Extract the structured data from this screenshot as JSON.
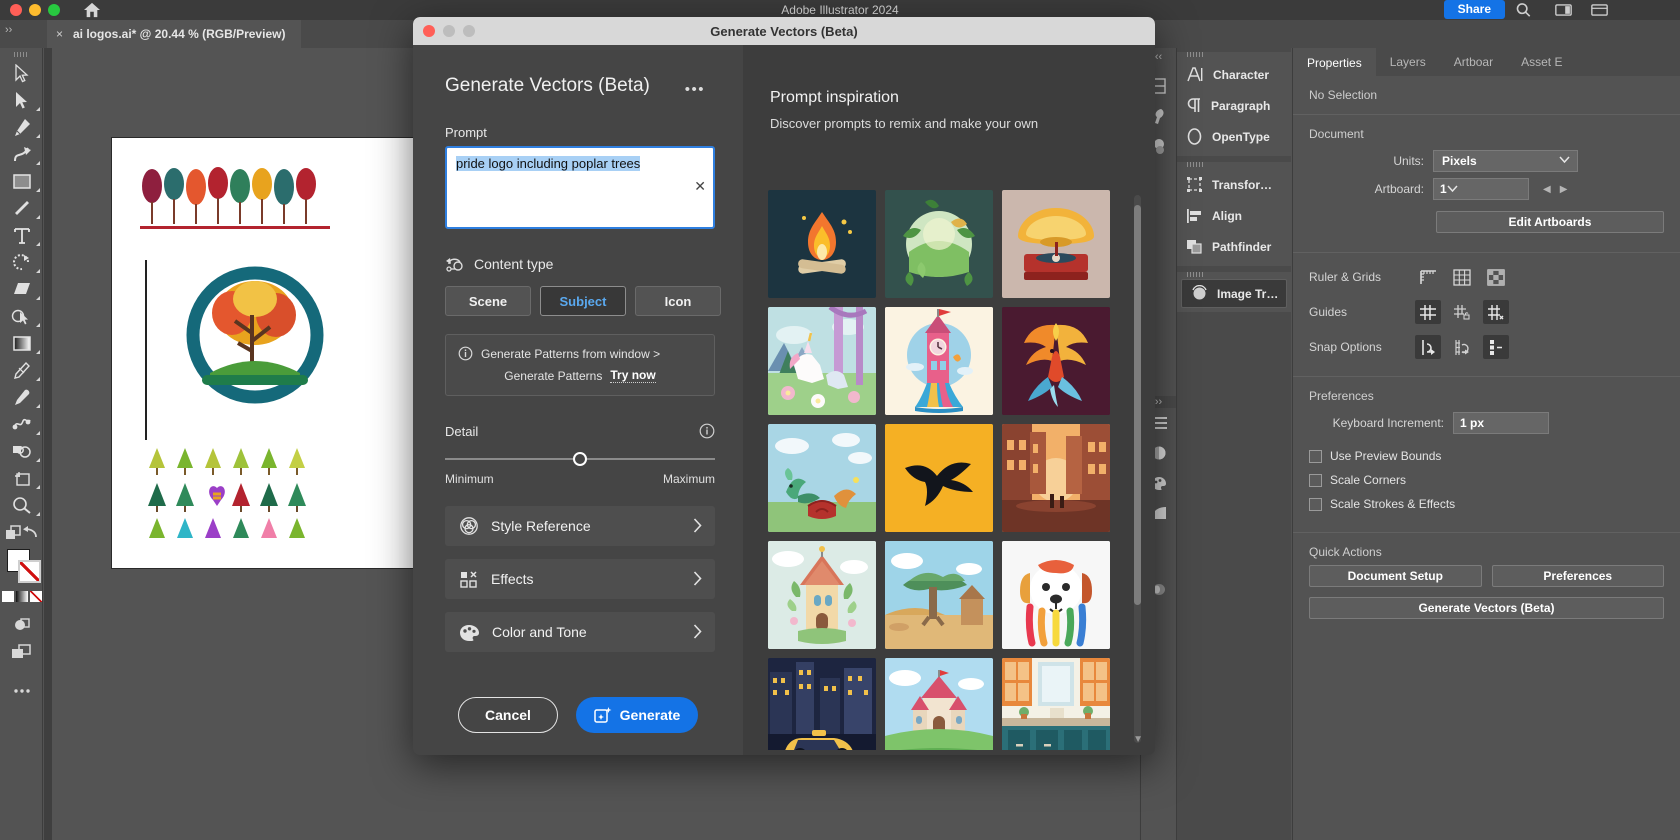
{
  "window": {
    "app_title": "Adobe Illustrator 2024",
    "share_label": "Share",
    "document_tab": "ai logos.ai* @ 20.44 % (RGB/Preview)",
    "tab_close": "×",
    "chevrons_left": "‹‹",
    "chevrons_right": "››"
  },
  "modal": {
    "titlebar": "Generate Vectors (Beta)",
    "heading": "Generate Vectors (Beta)",
    "overflow_menu": "•••",
    "prompt_label": "Prompt",
    "prompt_value": "pride logo including poplar trees",
    "prompt_clear": "✕",
    "content_type_label": "Content type",
    "content_types": [
      {
        "label": "Scene",
        "selected": false
      },
      {
        "label": "Subject",
        "selected": true
      },
      {
        "label": "Icon",
        "selected": false
      }
    ],
    "info_line1": "Generate Patterns from window >",
    "info_line2": "Generate Patterns",
    "info_link": "Try now",
    "detail_label": "Detail",
    "detail_min": "Minimum",
    "detail_max": "Maximum",
    "detail_value": 50,
    "accordions": [
      {
        "label": "Style Reference",
        "icon": "venn-circles-icon"
      },
      {
        "label": "Effects",
        "icon": "effects-grid-icon"
      },
      {
        "label": "Color and Tone",
        "icon": "palette-icon"
      }
    ],
    "cancel_label": "Cancel",
    "generate_label": "Generate",
    "inspiration_title": "Prompt inspiration",
    "inspiration_subtitle": "Discover prompts to remix and make your own",
    "accent_blue": "#1473e6",
    "selection_blue": "#a8d0f5",
    "gallery": [
      {
        "name": "campfire",
        "bg": "#1c3440"
      },
      {
        "name": "leafy-globe",
        "bg": "#33514d"
      },
      {
        "name": "gramophone",
        "bg": "#cbb7ad"
      },
      {
        "name": "unicorn-forest",
        "bg": "#8fc1c4"
      },
      {
        "name": "rainbow-clock-tower",
        "bg": "#fbf3e2"
      },
      {
        "name": "phoenix",
        "bg": "#4a1a30"
      },
      {
        "name": "dragon-sky",
        "bg": "#8fc4d6"
      },
      {
        "name": "bird-silhouette",
        "bg": "#f5b024"
      },
      {
        "name": "desert-street",
        "bg": "#7c4535"
      },
      {
        "name": "fairy-tower",
        "bg": "#cfe5e0"
      },
      {
        "name": "savannah-tree",
        "bg": "#8fc7dd"
      },
      {
        "name": "rainbow-dog",
        "bg": "#f2f2f2"
      },
      {
        "name": "night-city-taxi",
        "bg": "#1d2540"
      },
      {
        "name": "castle-hill",
        "bg": "#a8d8ee"
      },
      {
        "name": "kitchen-interior",
        "bg": "#f0efe7"
      }
    ]
  },
  "properties": {
    "tabs": [
      {
        "label": "Properties",
        "active": true
      },
      {
        "label": "Layers",
        "active": false
      },
      {
        "label": "Artboar",
        "active": false
      },
      {
        "label": "Asset E",
        "active": false
      }
    ],
    "selection_status": "No Selection",
    "document_section": "Document",
    "units_label": "Units:",
    "units_value": "Pixels",
    "artboard_label": "Artboard:",
    "artboard_value": "1",
    "edit_artboards": "Edit Artboards",
    "ruler_grids_label": "Ruler & Grids",
    "guides_label": "Guides",
    "snap_options_label": "Snap Options",
    "preferences_section": "Preferences",
    "keyboard_increment_label": "Keyboard Increment:",
    "keyboard_increment_value": "1 px",
    "checkboxes": [
      {
        "label": "Use Preview Bounds",
        "checked": false
      },
      {
        "label": "Scale Corners",
        "checked": false
      },
      {
        "label": "Scale Strokes & Effects",
        "checked": false
      }
    ],
    "quick_actions_section": "Quick Actions",
    "quick_actions": [
      "Document Setup",
      "Preferences",
      "Generate Vectors (Beta)"
    ]
  },
  "panel_rail": {
    "group1": [
      {
        "label": "Character",
        "icon": "character-icon",
        "selected": false
      },
      {
        "label": "Paragraph",
        "icon": "paragraph-icon",
        "selected": false
      },
      {
        "label": "OpenType",
        "icon": "opentype-icon",
        "selected": false
      }
    ],
    "group2": [
      {
        "label": "Transfor…",
        "icon": "transform-icon",
        "selected": false
      },
      {
        "label": "Align",
        "icon": "align-icon",
        "selected": false
      },
      {
        "label": "Pathfinder",
        "icon": "pathfinder-icon",
        "selected": false
      }
    ],
    "group3": [
      {
        "label": "Image Tr…",
        "icon": "image-trace-icon",
        "selected": true
      }
    ]
  },
  "toolbar": {
    "tools": [
      "selection-tool",
      "direct-selection-tool",
      "pen-tool",
      "curvature-tool",
      "rectangle-tool",
      "paintbrush-tool",
      "type-tool",
      "rotate-tool",
      "eraser-tool",
      "shaper-tool",
      "gradient-tool",
      "width-tool",
      "eyedropper-tool",
      "blend-tool",
      "shape-builder-tool",
      "artboard-tool",
      "zoom-tool",
      "arrange-tool",
      "undo-tool"
    ],
    "fill_stroke": "fill-stroke-swatches",
    "screen_mode": "screen-mode-icon",
    "more_tools": "more-tools-icon"
  }
}
